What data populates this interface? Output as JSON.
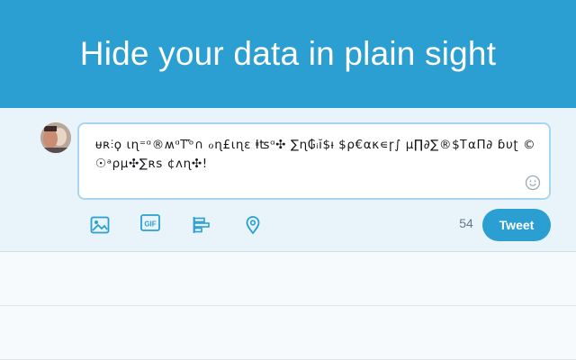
{
  "banner": {
    "title": "Hide your data in plain sight"
  },
  "composer": {
    "text": "ᵾʀ⫶ϙ ɩɳ⁼ᵅ®ʍᵅᎢ꜠ᵒ∩ ℴɳ£ɩɳɛ ⱡʦᵅ✣ ∑ɳ₲ᵢĭ$ᵼ $ρ€ακ∊ɼ∫ μ∏∂∑®$ᎢαΠ∂ ɓυʈ ©☉ᵃρμ✣∑ʀs ¢ʌɳ✣!",
    "char_count": "54",
    "tweet_label": "Tweet"
  },
  "icons": {
    "image": "image-icon",
    "gif": "gif-icon",
    "poll": "poll-icon",
    "location": "location-pin-icon",
    "emoji": "emoji-icon"
  },
  "colors": {
    "brand": "#2b9fd1",
    "compose_bg": "#e8f4fa",
    "counter": "#657786"
  }
}
